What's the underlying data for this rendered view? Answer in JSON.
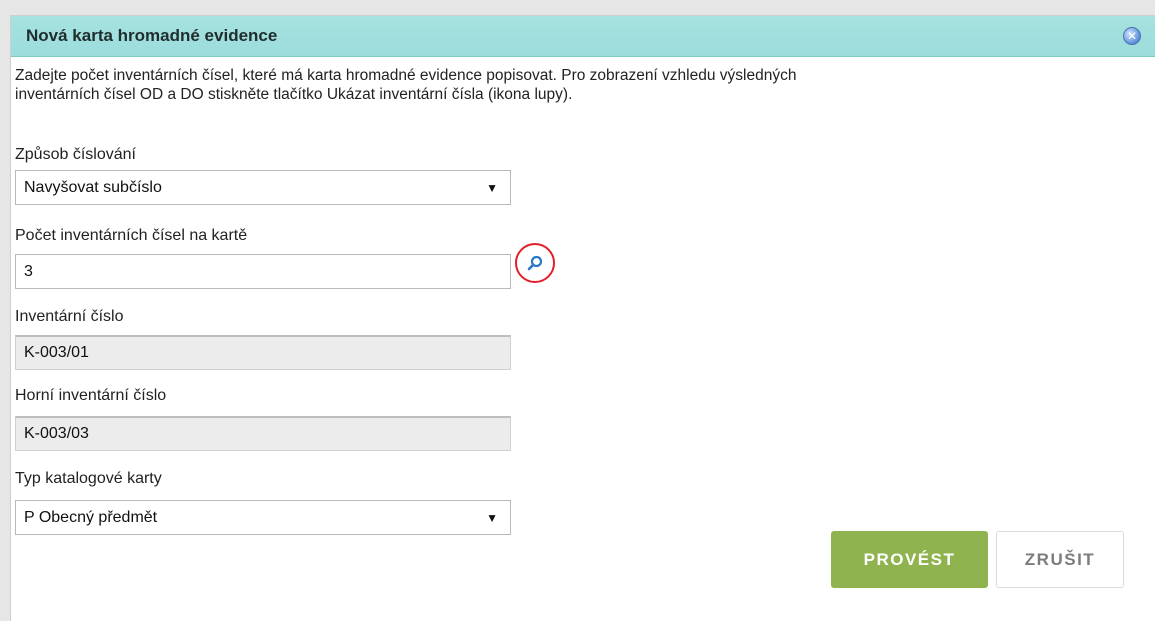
{
  "dialog": {
    "title": "Nová karta hromadné evidence",
    "intro_line1": "Zadejte počet inventárních čísel, které má karta hromadné evidence popisovat. Pro zobrazení vzhledu výsledných",
    "intro_line2": "inventárních čísel OD a DO stiskněte tlačítko Ukázat inventární čísla (ikona lupy)."
  },
  "form": {
    "numbering_label": "Způsob číslování",
    "numbering_value": "Navyšovat subčíslo",
    "count_label": "Počet inventárních čísel na kartě",
    "count_value": "3",
    "inv_number_label": "Inventární číslo",
    "inv_number_value": "K-003/01",
    "upper_inv_number_label": "Horní inventární číslo",
    "upper_inv_number_value": "K-003/03",
    "catalog_type_label": "Typ katalogové karty",
    "catalog_type_value": "P Obecný předmět"
  },
  "buttons": {
    "confirm": "PROVÉST",
    "cancel": "ZRUŠIT"
  },
  "colors": {
    "titlebar": "#a6e3e1",
    "confirm_bg": "#8fb44f",
    "highlight_circle": "#e32029",
    "search_icon": "#2a78c8"
  }
}
